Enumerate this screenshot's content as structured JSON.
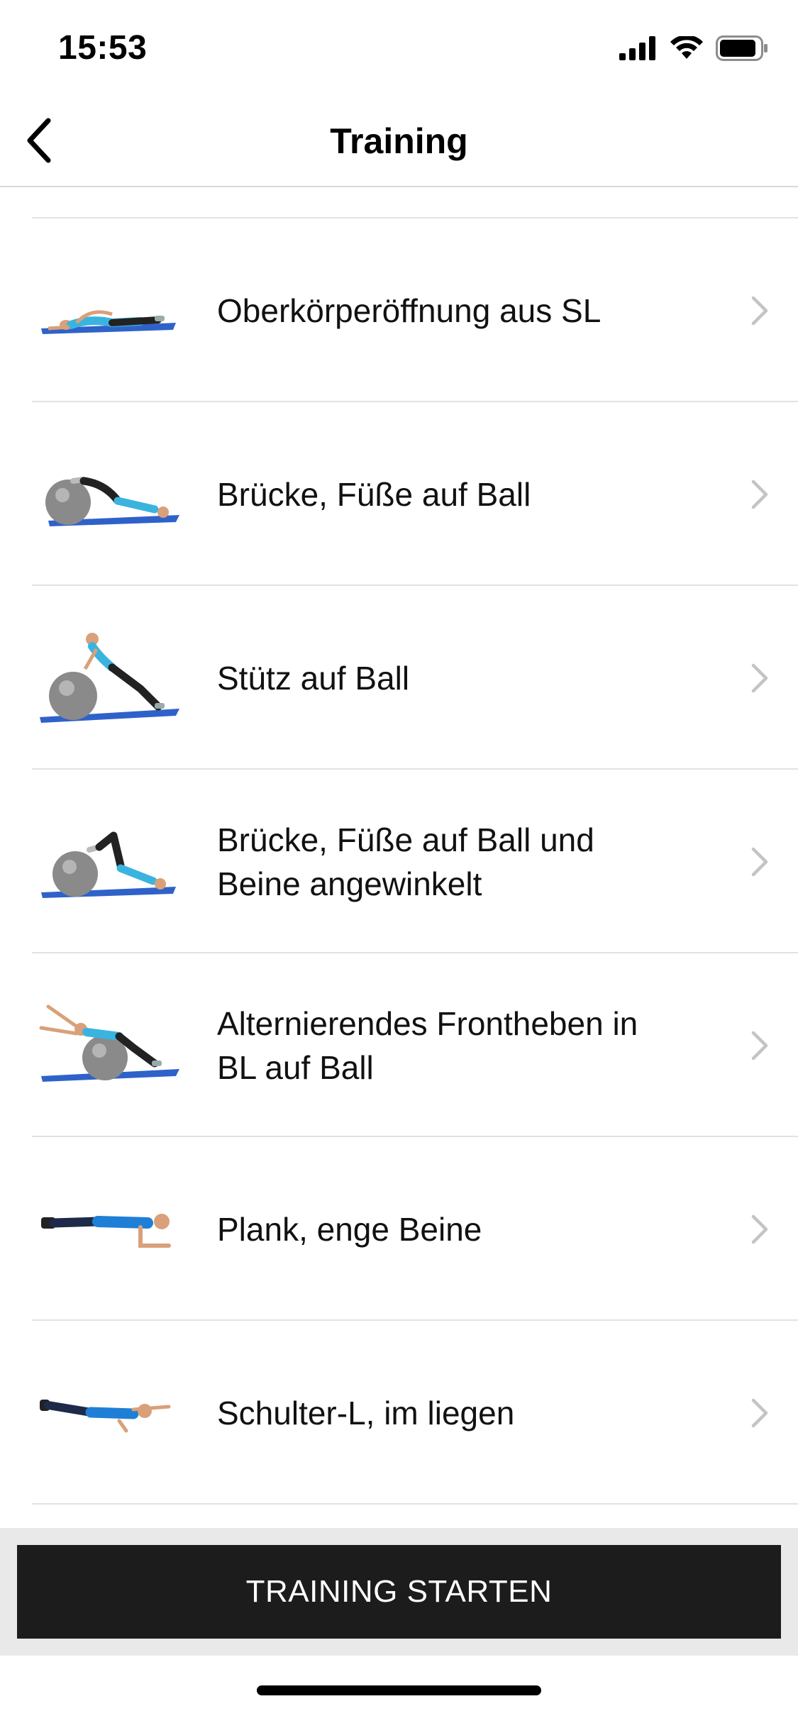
{
  "status_bar": {
    "time": "15:53"
  },
  "nav": {
    "title": "Training",
    "back_icon": "chevron-left-icon"
  },
  "exercises": [
    {
      "label": "Oberkörperöffnung aus SL",
      "thumb": "stretch-side-lying"
    },
    {
      "label": "Brücke, Füße auf Ball",
      "thumb": "bridge-feet-on-ball"
    },
    {
      "label": "Stütz auf Ball",
      "thumb": "push-up-on-ball"
    },
    {
      "label": "Brücke, Füße auf Ball und Beine angewinkelt",
      "thumb": "bridge-ball-bent-legs"
    },
    {
      "label": "Alternierendes Frontheben in BL auf Ball",
      "thumb": "prone-front-raise-ball"
    },
    {
      "label": "Plank, enge Beine",
      "thumb": "plank"
    },
    {
      "label": "Schulter-L, im liegen",
      "thumb": "prone-shoulder-l"
    }
  ],
  "footer": {
    "start_label": "TRAINING STARTEN"
  },
  "colors": {
    "mat_blue": "#2f62c9",
    "ball_grey": "#8a8a8a",
    "shirt_cyan": "#3ab4df",
    "button_dark": "#1c1c1c"
  }
}
